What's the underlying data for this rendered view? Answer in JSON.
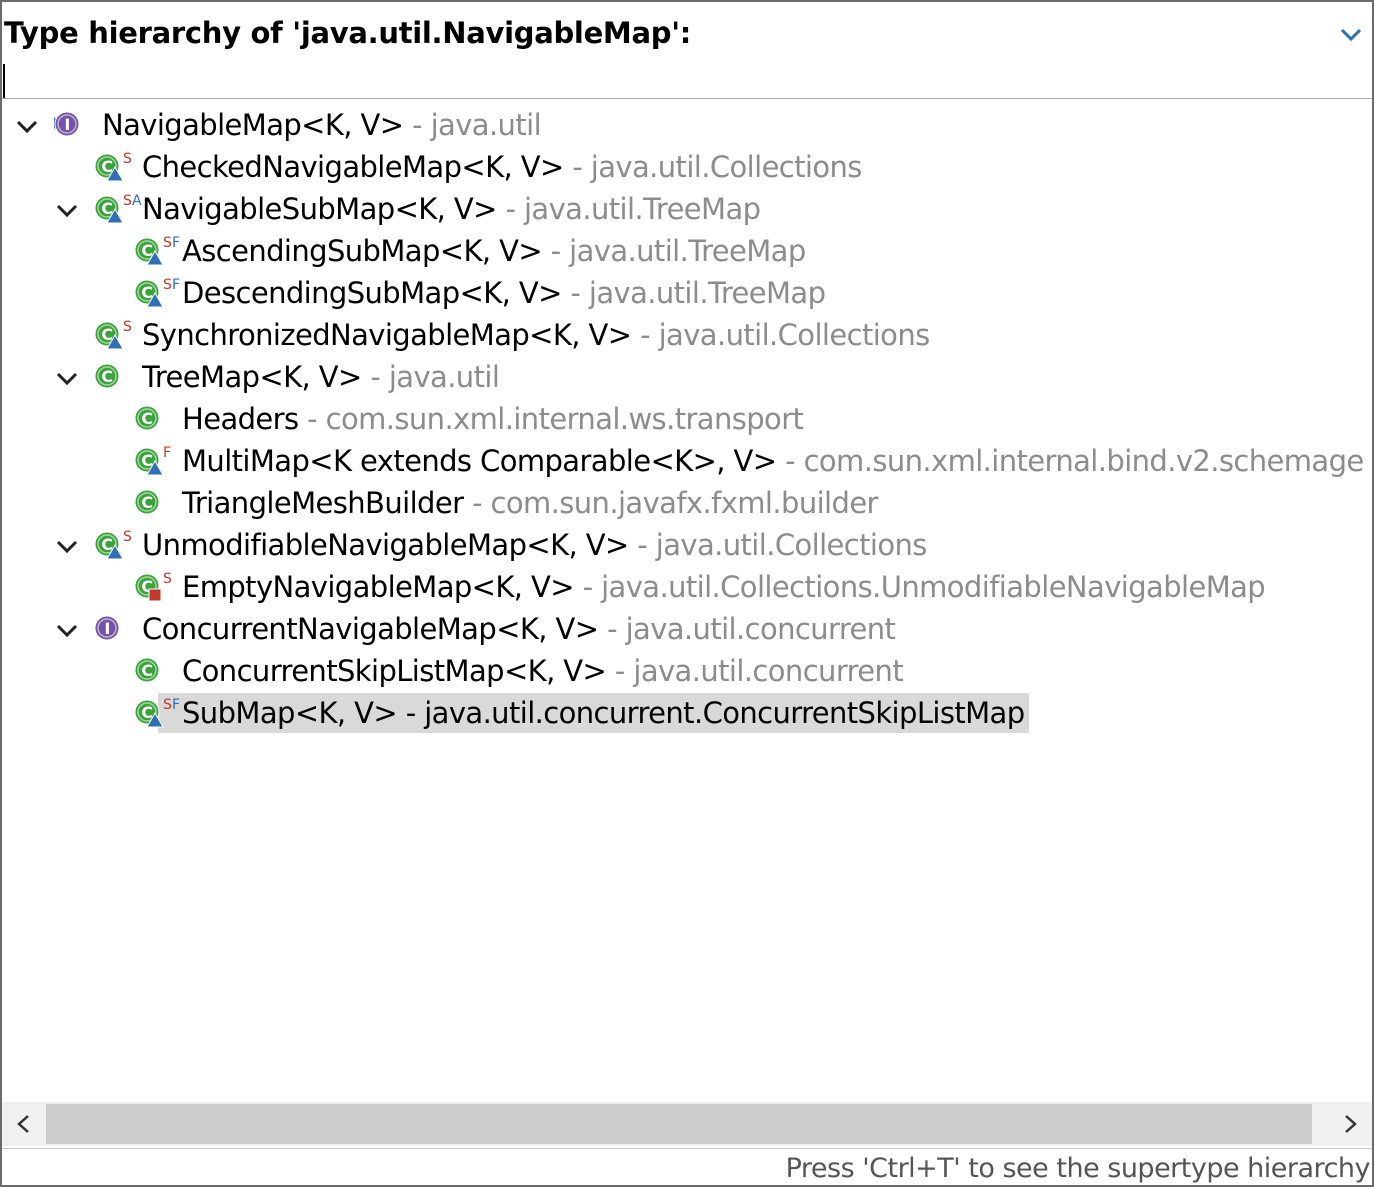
{
  "header": {
    "title": "Type hierarchy of 'java.util.NavigableMap':",
    "menu_icon": "chevron-down-icon",
    "filter_value": ""
  },
  "tree": {
    "items": [
      {
        "name": "NavigableMap<K, V>",
        "sep": " - ",
        "package": "java.util",
        "kind": "interface",
        "modifiers": "",
        "expanded": true,
        "depth": 0
      },
      {
        "name": "CheckedNavigableMap<K, V>",
        "sep": " - ",
        "package": "java.util.Collections",
        "kind": "class",
        "modifiers": "S",
        "expanded": false,
        "depth": 1
      },
      {
        "name": "NavigableSubMap<K, V>",
        "sep": " - ",
        "package": "java.util.TreeMap",
        "kind": "class",
        "modifiers": "SA",
        "expanded": true,
        "depth": 1
      },
      {
        "name": "AscendingSubMap<K, V>",
        "sep": " - ",
        "package": "java.util.TreeMap",
        "kind": "class",
        "modifiers": "SF",
        "expanded": false,
        "depth": 2
      },
      {
        "name": "DescendingSubMap<K, V>",
        "sep": " - ",
        "package": "java.util.TreeMap",
        "kind": "class",
        "modifiers": "SF",
        "expanded": false,
        "depth": 2
      },
      {
        "name": "SynchronizedNavigableMap<K, V>",
        "sep": " - ",
        "package": "java.util.Collections",
        "kind": "class",
        "modifiers": "S",
        "expanded": false,
        "depth": 1
      },
      {
        "name": "TreeMap<K, V>",
        "sep": " - ",
        "package": "java.util",
        "kind": "class",
        "modifiers": "",
        "expanded": true,
        "depth": 1
      },
      {
        "name": "Headers",
        "sep": " - ",
        "package": "com.sun.xml.internal.ws.transport",
        "kind": "class",
        "modifiers": "",
        "expanded": false,
        "depth": 2
      },
      {
        "name": "MultiMap<K extends Comparable<K>, V>",
        "sep": " - ",
        "package": "com.sun.xml.internal.bind.v2.schemage",
        "kind": "class",
        "modifiers": "F",
        "expanded": false,
        "depth": 2
      },
      {
        "name": "TriangleMeshBuilder",
        "sep": " - ",
        "package": "com.sun.javafx.fxml.builder",
        "kind": "class",
        "modifiers": "",
        "expanded": false,
        "depth": 2
      },
      {
        "name": "UnmodifiableNavigableMap<K, V>",
        "sep": " - ",
        "package": "java.util.Collections",
        "kind": "class",
        "modifiers": "S",
        "expanded": true,
        "depth": 1
      },
      {
        "name": "EmptyNavigableMap<K, V>",
        "sep": " - ",
        "package": "java.util.Collections.UnmodifiableNavigableMap",
        "kind": "class-private",
        "modifiers": "S",
        "expanded": false,
        "depth": 2
      },
      {
        "name": "ConcurrentNavigableMap<K, V>",
        "sep": " - ",
        "package": "java.util.concurrent",
        "kind": "interface",
        "modifiers": "",
        "expanded": true,
        "depth": 1
      },
      {
        "name": "ConcurrentSkipListMap<K, V>",
        "sep": " - ",
        "package": "java.util.concurrent",
        "kind": "class",
        "modifiers": "",
        "expanded": false,
        "depth": 2
      },
      {
        "name": "SubMap<K, V>",
        "sep": " - ",
        "package": "java.util.concurrent.ConcurrentSkipListMap",
        "kind": "class",
        "modifiers": "SF",
        "expanded": false,
        "depth": 2,
        "selected": true
      }
    ]
  },
  "scrollbar": {
    "left_icon": "chevron-left-icon",
    "right_icon": "chevron-right-icon"
  },
  "status": {
    "text": "Press 'Ctrl+T' to see the supertype hierarchy"
  },
  "colors": {
    "class_icon": "#3aa33a",
    "interface_icon": "#7452a8",
    "package_text": "#8c8c8c",
    "selection": "#d9d9d9",
    "modifier_red": "#c0392b",
    "default_marker": "#2f6fb8"
  }
}
